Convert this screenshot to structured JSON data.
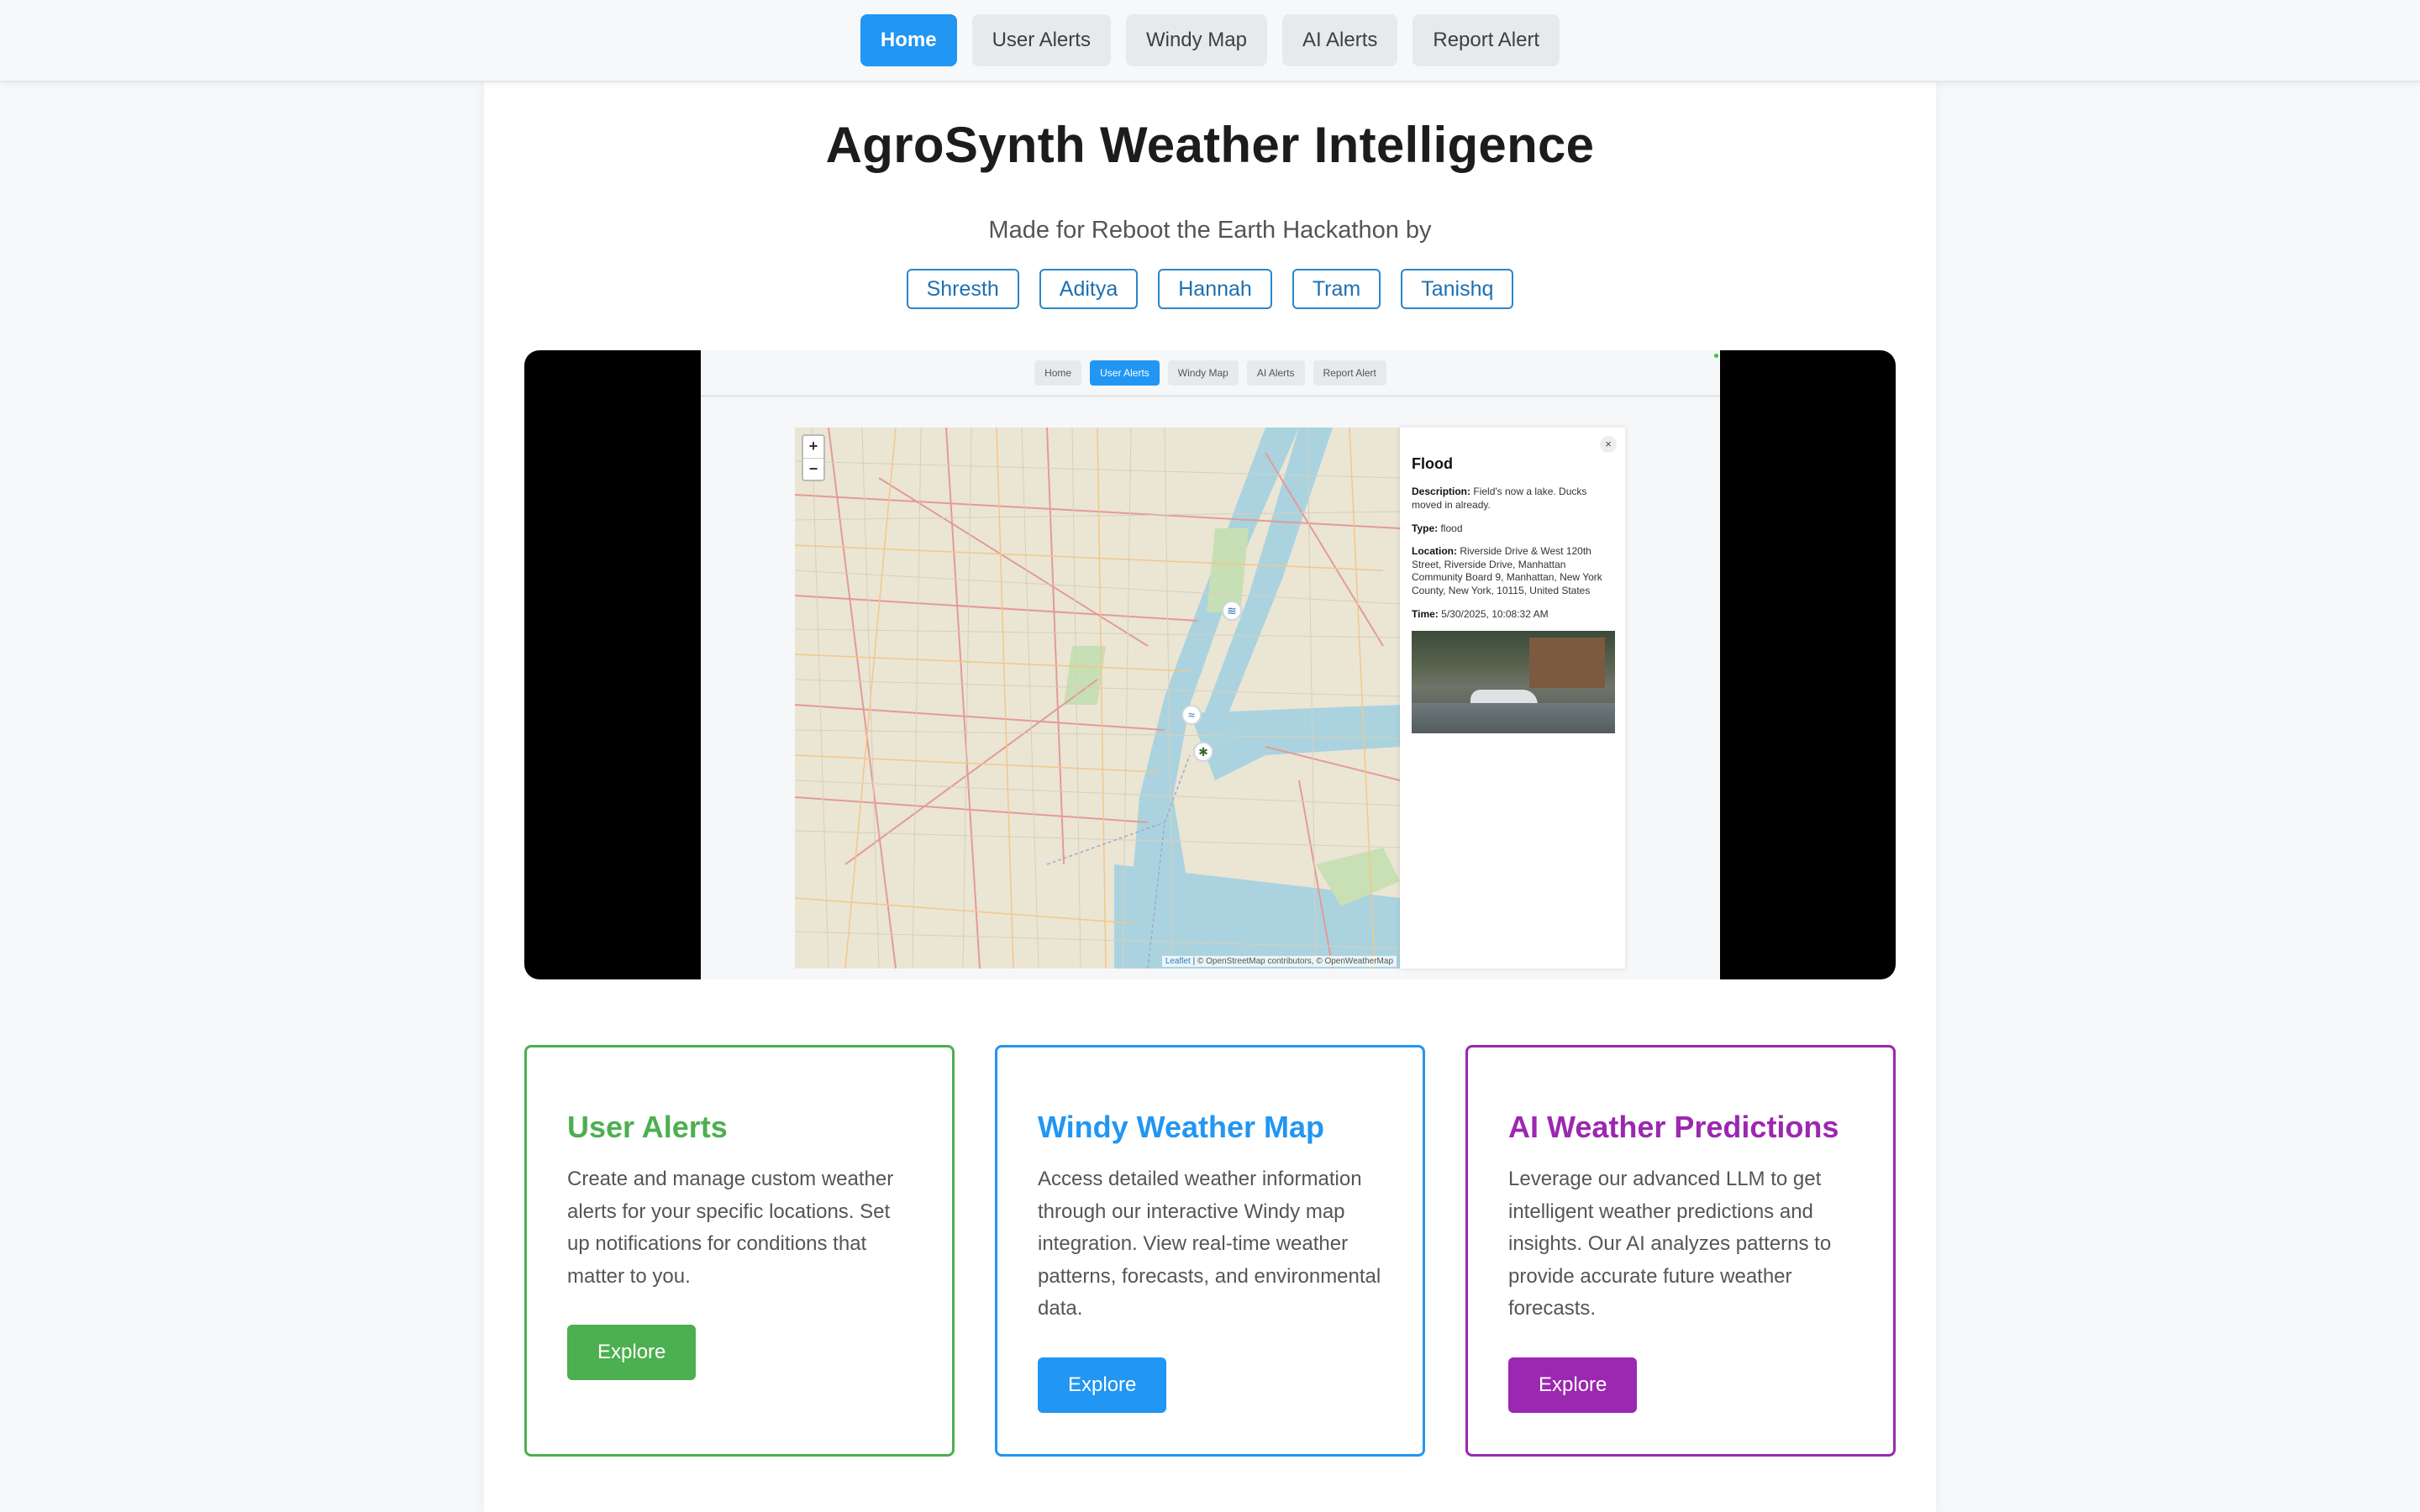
{
  "nav": {
    "items": [
      {
        "label": "Home",
        "active": true
      },
      {
        "label": "User Alerts",
        "active": false
      },
      {
        "label": "Windy Map",
        "active": false
      },
      {
        "label": "AI Alerts",
        "active": false
      },
      {
        "label": "Report Alert",
        "active": false
      }
    ]
  },
  "hero": {
    "title": "AgroSynth Weather Intelligence",
    "subtitle": "Made for Reboot the Earth Hackathon by",
    "team": [
      "Shresth",
      "Aditya",
      "Hannah",
      "Tram",
      "Tanishq"
    ]
  },
  "demo": {
    "nav": [
      "Home",
      "User Alerts",
      "Windy Map",
      "AI Alerts",
      "Report Alert"
    ],
    "active_nav": "User Alerts",
    "map": {
      "zoom_in": "+",
      "zoom_out": "−",
      "attribution_link": "Leaflet",
      "attribution_text": "| © OpenStreetMap contributors, © OpenWeatherMap",
      "markers": [
        {
          "name": "flood-marker",
          "icon": "water-waves-icon",
          "glyph": "≋"
        },
        {
          "name": "wind-marker",
          "icon": "wind-icon",
          "glyph": "≈"
        },
        {
          "name": "pest-marker",
          "icon": "bug-icon",
          "glyph": "✱"
        }
      ]
    },
    "popup": {
      "close": "×",
      "title": "Flood",
      "description_label": "Description:",
      "description": "Field's now a lake. Ducks moved in already.",
      "type_label": "Type:",
      "type": "flood",
      "location_label": "Location:",
      "location": "Riverside Drive & West 120th Street, Riverside Drive, Manhattan Community Board 9, Manhattan, New York County, New York, 10115, United States",
      "time_label": "Time:",
      "time": "5/30/2025, 10:08:32 AM"
    }
  },
  "cards": [
    {
      "title": "User Alerts",
      "text": "Create and manage custom weather alerts for your specific locations. Set up notifications for conditions that matter to you.",
      "button": "Explore",
      "color": "#4caf50"
    },
    {
      "title": "Windy Weather Map",
      "text": "Access detailed weather information through our interactive Windy map integration. View real-time weather patterns, forecasts, and environmental data.",
      "button": "Explore",
      "color": "#2196f3"
    },
    {
      "title": "AI Weather Predictions",
      "text": "Leverage our advanced LLM to get intelligent weather predictions and insights. Our AI analyzes patterns to provide accurate future weather forecasts.",
      "button": "Explore",
      "color": "#9c27b0"
    }
  ],
  "colors": {
    "accent": "#2196f3",
    "green": "#4caf50",
    "purple": "#9c27b0",
    "team_border": "#2b86c9"
  }
}
